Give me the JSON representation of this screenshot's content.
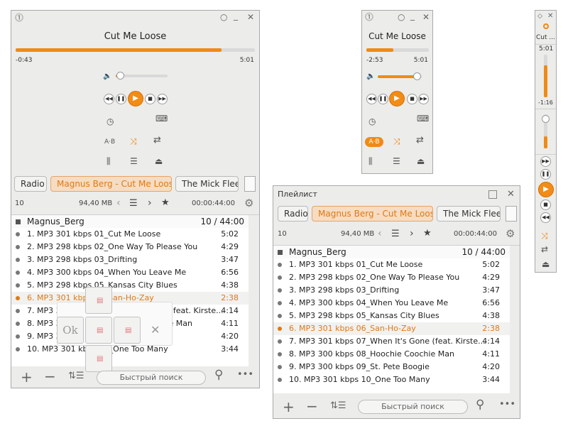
{
  "app": {
    "track_title": "Cut Me Loose",
    "title_short": "Cut ...",
    "playlist_window_title": "Плейлист"
  },
  "colors": {
    "accent": "#f08a16",
    "accent_text": "#e07a12"
  },
  "icons": {
    "app_menu": "circle-up-icon",
    "minimize_circle": "circle-icon",
    "minimize": "minimize-icon",
    "close": "close-icon",
    "volume": "speaker-icon",
    "prev": "prev-icon",
    "pause": "pause-icon",
    "play": "play-icon",
    "stop": "stop-icon",
    "next": "next-icon",
    "timer": "clock-icon",
    "record": "record-icon",
    "ab_repeat": "ab-repeat-icon",
    "shuffle": "shuffle-icon",
    "repeat": "repeat-icon",
    "equalizer": "equalizer-icon",
    "playlist": "list-icon",
    "eject": "eject-icon",
    "new_tab": "page-icon",
    "prev_arrow": "chevron-left-icon",
    "next_arrow": "chevron-right-icon",
    "menu": "hamburger-icon",
    "favorite": "star-icon",
    "settings": "gear-icon",
    "add": "plus-icon",
    "remove": "minus-icon",
    "sort": "sort-icon",
    "search": "search-icon",
    "more": "more-icon"
  },
  "main": {
    "elapsed": "-0:43",
    "total": "5:01",
    "progress": 0.86,
    "volume": 0.05,
    "ab_label": "A·B",
    "tabs": [
      "Radio",
      "Magnus Berg - Cut Me Loose",
      "The Mick Fleet"
    ],
    "info": {
      "count": "10",
      "size": "94,40 MB",
      "duration": "00:00:44:00"
    },
    "playlist_name": "Magnus_Berg",
    "playlist_count": "10 / 44:00",
    "search_placeholder": "Быстрый поиск",
    "tracks_visible": [
      {
        "title": "1. MP3 301 kbps 01_Cut Me Loose",
        "duration": "5:02"
      },
      {
        "title": "2. MP3 298 kbps 02_One Way To Please You",
        "duration": "4:29"
      },
      {
        "title": "3. MP3 298 kbps 03_Drifting",
        "duration": "3:47"
      },
      {
        "title": "4. MP3 300 kbps 04_When You Leave Me",
        "duration": "6:56"
      },
      {
        "title": "5. MP3 298 kbps 05_Kansas City Blues",
        "duration": "4:38"
      },
      {
        "title": "6. MP3 301 kbps 06_San-Ho-Zay",
        "duration": "2:38"
      },
      {
        "title": "7. MP3 301 kbps 07_When It's Gone (feat. Kirste...",
        "duration": "4:14"
      },
      {
        "title": "8. MP3 300 kbps 08_Hoochie Coochie Man",
        "duration": "4:11"
      },
      {
        "title": "9. MP3 300 kbps 09_St. Pete Boogie",
        "duration": "4:20"
      },
      {
        "title": "10. MP3 301 kbps 10_One Too Many",
        "duration": "3:44"
      }
    ],
    "dock": {
      "ok_label": "Ok",
      "cancel_label": "✕"
    }
  },
  "mini": {
    "elapsed": "-2:53",
    "total": "5:01",
    "progress": 0.43,
    "volume": 0.9,
    "ab_label": "A·B"
  },
  "vertical": {
    "total": "5:01",
    "elapsed": "-1:16",
    "progress": 0.75,
    "volume": 0.35
  },
  "playlist": {
    "tabs": [
      "Radio",
      "Magnus Berg - Cut Me Loose",
      "The Mick Fleet"
    ],
    "info": {
      "count": "10",
      "size": "94,40 MB",
      "duration": "00:00:44:00"
    },
    "playlist_name": "Magnus_Berg",
    "playlist_count": "10 / 44:00",
    "search_placeholder": "Быстрый поиск",
    "tracks": [
      {
        "title": "1. MP3 301 kbps 01_Cut Me Loose",
        "duration": "5:02"
      },
      {
        "title": "2. MP3 298 kbps 02_One Way To Please You",
        "duration": "4:29"
      },
      {
        "title": "3. MP3 298 kbps 03_Drifting",
        "duration": "3:47"
      },
      {
        "title": "4. MP3 300 kbps 04_When You Leave Me",
        "duration": "6:56"
      },
      {
        "title": "5. MP3 298 kbps 05_Kansas City Blues",
        "duration": "4:38"
      },
      {
        "title": "6. MP3 301 kbps 06_San-Ho-Zay",
        "duration": "2:38"
      },
      {
        "title": "7. MP3 301 kbps 07_When It's Gone (feat. Kirste...",
        "duration": "4:14"
      },
      {
        "title": "8. MP3 300 kbps 08_Hoochie Coochie Man",
        "duration": "4:11"
      },
      {
        "title": "9. MP3 300 kbps 09_St. Pete Boogie",
        "duration": "4:20"
      },
      {
        "title": "10. MP3 301 kbps 10_One Too Many",
        "duration": "3:44"
      }
    ]
  }
}
